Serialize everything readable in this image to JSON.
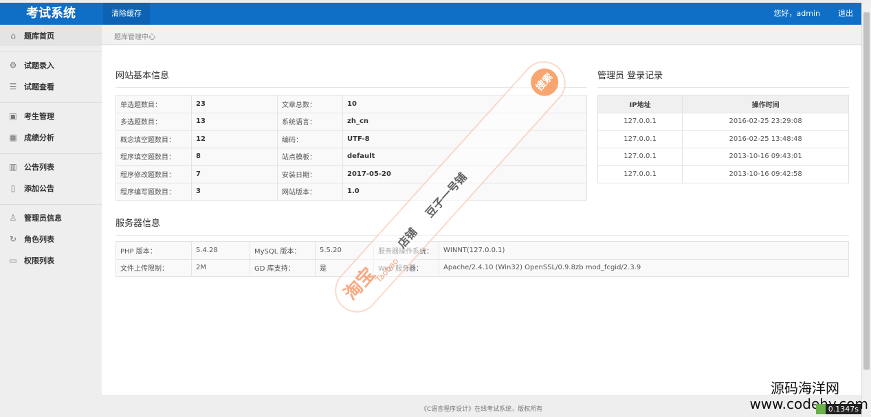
{
  "app": {
    "title": "考试系统",
    "clear_cache": "清除缓存",
    "greeting": "您好，admin",
    "logout": "退出"
  },
  "sidebar": {
    "items": [
      {
        "label": "题库首页",
        "icon": "home-icon"
      },
      {
        "label": "试题录入",
        "icon": "gear-icon"
      },
      {
        "label": "试题查看",
        "icon": "document-icon"
      },
      {
        "label": "考生管理",
        "icon": "grid-icon"
      },
      {
        "label": "成绩分析",
        "icon": "apps-icon"
      },
      {
        "label": "公告列表",
        "icon": "book-icon"
      },
      {
        "label": "添加公告",
        "icon": "page-icon"
      },
      {
        "label": "管理员信息",
        "icon": "user-icon"
      },
      {
        "label": "角色列表",
        "icon": "refresh-icon"
      },
      {
        "label": "权限列表",
        "icon": "monitor-icon"
      }
    ]
  },
  "breadcrumb": "题库管理中心",
  "site_info": {
    "title": "网站基本信息",
    "rows": [
      {
        "l1": "单选题数目：",
        "v1": "23",
        "l2": "文章总数：",
        "v2": "10"
      },
      {
        "l1": "多选题数目：",
        "v1": "13",
        "l2": "系统语言：",
        "v2": "zh_cn"
      },
      {
        "l1": "概念填空题数目：",
        "v1": "12",
        "l2": "编码：",
        "v2": "UTF-8"
      },
      {
        "l1": "程序填空题数目：",
        "v1": "8",
        "l2": "站点模板：",
        "v2": "default"
      },
      {
        "l1": "程序修改题数目：",
        "v1": "7",
        "l2": "安装日期：",
        "v2": "2017-05-20"
      },
      {
        "l1": "程序编写题数目：",
        "v1": "3",
        "l2": "网站版本：",
        "v2": "1.0"
      }
    ]
  },
  "login_log": {
    "title": "管理员 登录记录",
    "headers": [
      "IP地址",
      "操作时间"
    ],
    "rows": [
      [
        "127.0.0.1",
        "2016-02-25 23:29:08"
      ],
      [
        "127.0.0.1",
        "2016-02-25 13:48:48"
      ],
      [
        "127.0.0.1",
        "2013-10-16 09:43:01"
      ],
      [
        "127.0.0.1",
        "2013-10-16 09:42:58"
      ]
    ]
  },
  "server_info": {
    "title": "服务器信息",
    "rows": [
      {
        "l1": "PHP 版本：",
        "v1": "5.4.28",
        "l2": "MySQL 版本：",
        "v2": "5.5.20",
        "l3": "服务器操作系统：",
        "v3": "WINNT(127.0.0.1)"
      },
      {
        "l1": "文件上传限制：",
        "v1": "2M",
        "l2": "GD 库支持：",
        "v2": "是",
        "l3": "Web 服务器：",
        "v3": "Apache/2.4.10 (Win32) OpenSSL/0.9.8zb mod_fcgid/2.3.9"
      }
    ]
  },
  "footer": "《C语言程序设计》在线考试系统，版权所有",
  "watermark": {
    "taobao_cn": "淘宝",
    "taobao_en": "Taobao",
    "shop": "店铺",
    "owner": "豆子一号铺",
    "search": "搜索"
  },
  "site_watermark": {
    "name": "源码海洋网",
    "url": "www.codehy.com"
  },
  "timer": "0.1347s"
}
